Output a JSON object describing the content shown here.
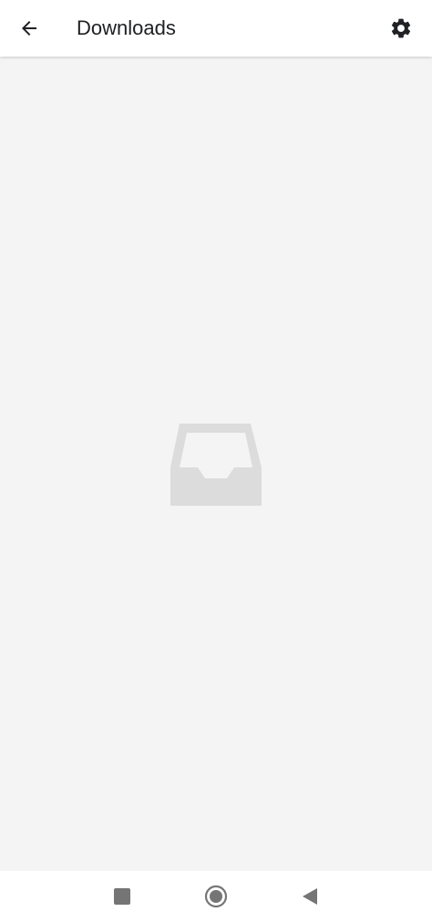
{
  "app_bar": {
    "title": "Downloads",
    "back_icon": "arrow-back-icon",
    "settings_icon": "gear-icon"
  },
  "content": {
    "empty_state_icon": "inbox-tray-icon"
  },
  "nav_bar": {
    "buttons": [
      {
        "name": "recents",
        "icon": "square-icon"
      },
      {
        "name": "home",
        "icon": "circle-icon"
      },
      {
        "name": "back",
        "icon": "triangle-back-icon"
      }
    ]
  },
  "colors": {
    "app_bar_bg": "#ffffff",
    "content_bg": "#f4f4f4",
    "title_text": "#202124",
    "empty_icon": "#dcdcdc",
    "nav_icon": "#757575"
  }
}
